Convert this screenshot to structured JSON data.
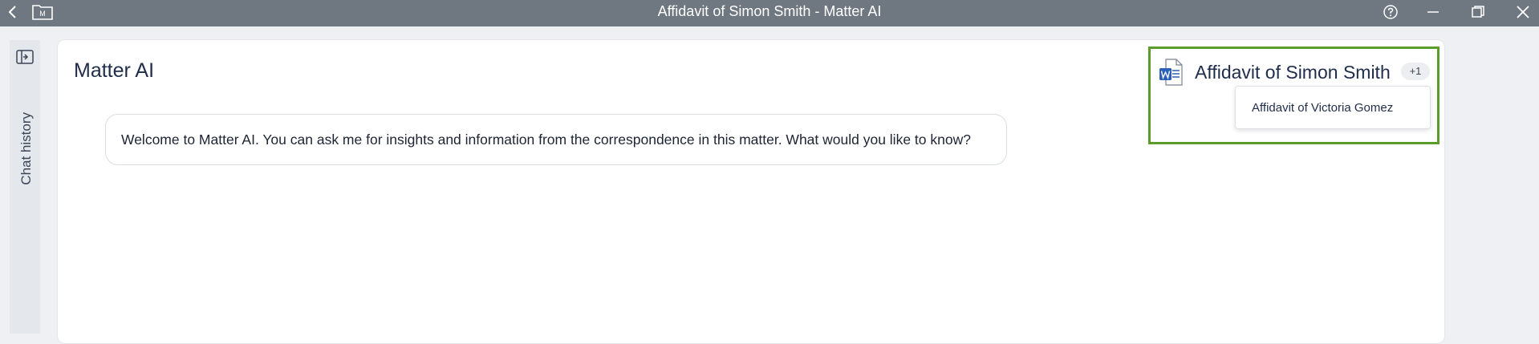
{
  "window": {
    "title": "Affidavit of Simon Smith - Matter AI",
    "app_icon_letter": "M"
  },
  "sidebar": {
    "chat_history_label": "Chat history"
  },
  "main": {
    "heading": "Matter AI",
    "welcome_message": "Welcome to Matter AI. You can ask me for insights and information from the correspondence in this matter. What would you like to know?"
  },
  "document_selector": {
    "selected_document": "Affidavit of Simon Smith",
    "extra_count": "+1",
    "icon": "word-document-icon",
    "options": [
      {
        "label": "Affidavit of Victoria Gomez"
      }
    ],
    "highlight_color": "#5c9c2a"
  },
  "colors": {
    "titlebar_bg": "#6f7781",
    "word_blue": "#2b5fb8"
  }
}
